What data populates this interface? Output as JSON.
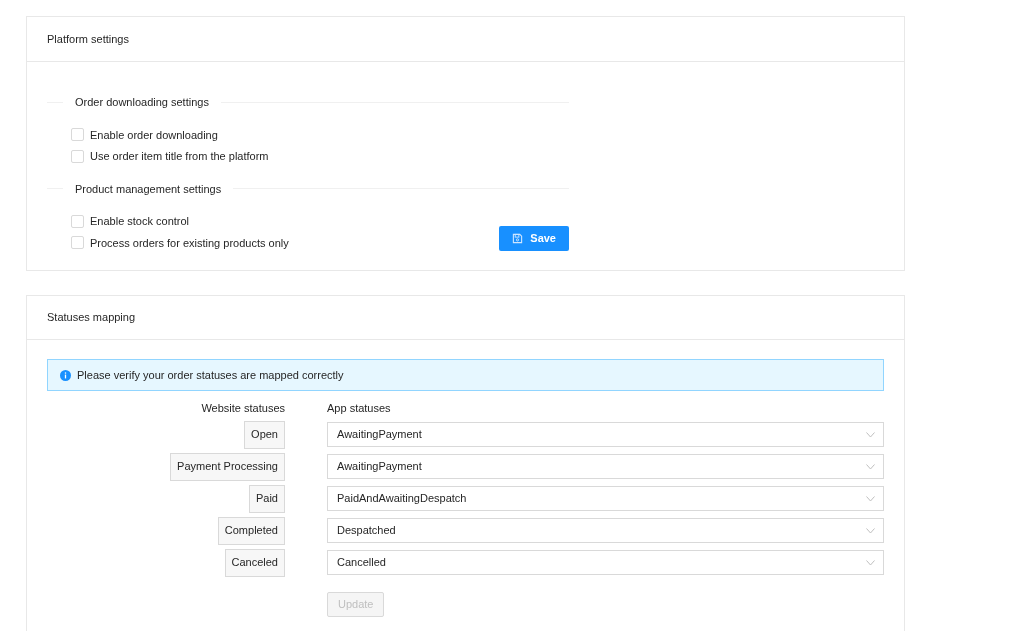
{
  "platform_settings": {
    "title": "Platform settings",
    "sections": [
      {
        "title": "Order downloading settings",
        "options": [
          {
            "label": "Enable order downloading",
            "checked": false
          },
          {
            "label": "Use order item title from the platform",
            "checked": false
          }
        ]
      },
      {
        "title": "Product management settings",
        "options": [
          {
            "label": "Enable stock control",
            "checked": false
          },
          {
            "label": "Process orders for existing products only",
            "checked": false
          }
        ]
      }
    ],
    "save_button": "Save"
  },
  "statuses_mapping": {
    "title": "Statuses mapping",
    "info": "Please verify your order statuses are mapped correctly",
    "columns": [
      "Website statuses",
      "App statuses"
    ],
    "rows": [
      {
        "website": "Open",
        "app": "AwaitingPayment"
      },
      {
        "website": "Payment Processing",
        "app": "AwaitingPayment"
      },
      {
        "website": "Paid",
        "app": "PaidAndAwaitingDespatch"
      },
      {
        "website": "Completed",
        "app": "Despatched"
      },
      {
        "website": "Canceled",
        "app": "Cancelled"
      }
    ],
    "update_button": {
      "label": "Update",
      "disabled": true
    }
  }
}
